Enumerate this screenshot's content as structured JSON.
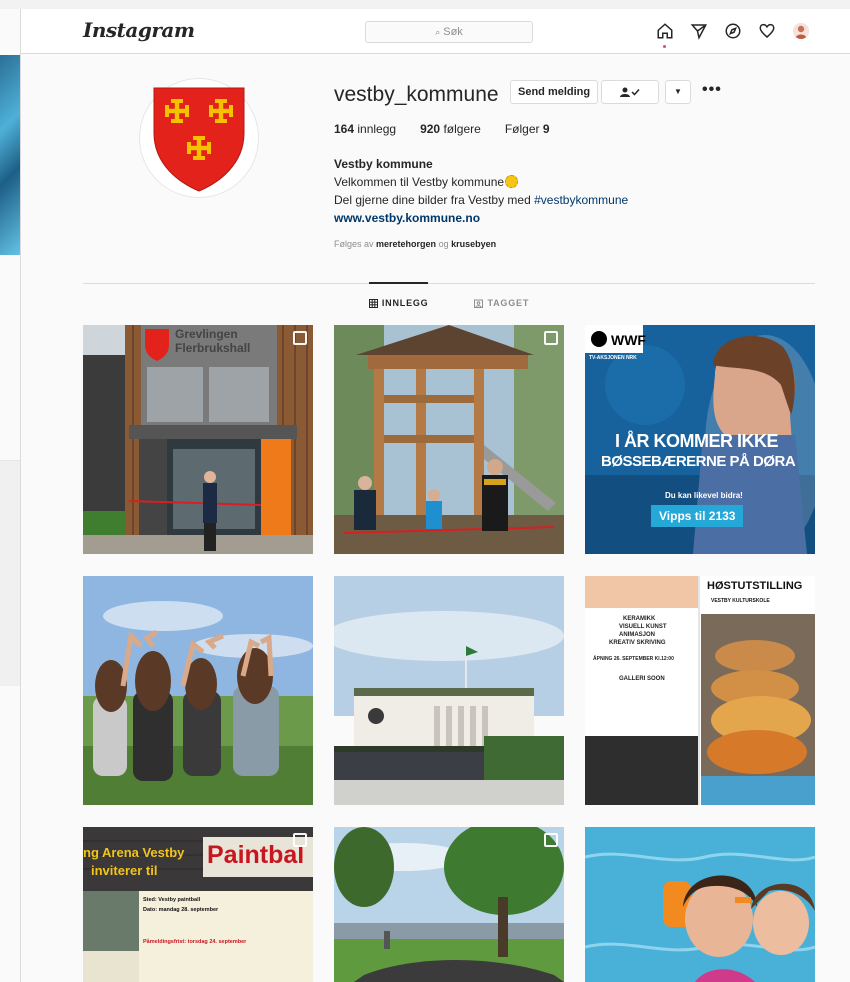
{
  "app": {
    "logo": "Instagram"
  },
  "search": {
    "placeholder": "Søk",
    "icon": "search-icon"
  },
  "nav": {
    "icons": [
      "home-icon",
      "direct-icon",
      "explore-icon",
      "activity-heart-icon",
      "profile-avatar-icon"
    ]
  },
  "profile": {
    "username": "vestby_kommune",
    "send_message_label": "Send melding",
    "posts_count": "164",
    "posts_label": "innlegg",
    "followers_count": "920",
    "followers_label": "følgere",
    "following_label": "Følger",
    "following_count": "9",
    "full_name": "Vestby kommune",
    "bio_line1": "Velkommen til Vestby kommune",
    "bio_line2_prefix": "Del gjerne dine bilder fra Vestby med",
    "hashtag": "#vestbykommune",
    "website": "www.vestby.kommune.no",
    "followed_by_prefix": "Følges av",
    "followed_by_user1": "meretehorgen",
    "followed_by_sep": "og",
    "followed_by_user2": "krusebyen"
  },
  "tabs": [
    {
      "label": "INNLEGG",
      "icon": "grid-icon",
      "active": true
    },
    {
      "label": "TAGGET",
      "icon": "tag-icon",
      "active": false
    }
  ],
  "posts": [
    {
      "overlay": [
        "Grevlingen",
        "Flerbrukshall"
      ]
    },
    {
      "overlay": []
    },
    {
      "overlay": [
        "WWF",
        "TV-AKSJONEN NRK",
        "I ÅR KOMMER IKKE",
        "BØSSEBÆRERNE PÅ DØRA",
        "Du kan likevel bidra!",
        "Vipps til 2133"
      ]
    },
    {
      "overlay": []
    },
    {
      "overlay": []
    },
    {
      "overlay": [
        "HØSTUTSTILLING",
        "VESTBY KULTURSKOLE",
        "KERAMIKK",
        "VISUELL KUNST",
        "ANIMASJON",
        "KREATIV SKRIVING",
        "ÅPNING 26. SEPTEMBER Kl.12:00",
        "GALLERI SOON"
      ]
    },
    {
      "overlay": [
        "ng Arena Vestby",
        "inviterer til",
        "Paintbal",
        "Sted: Vestby paintball",
        "Dato: mandag 28. september",
        "Påmeldingsfrist: torsdag 24. september"
      ]
    },
    {
      "overlay": []
    },
    {
      "overlay": []
    }
  ],
  "colors": {
    "accent": "#00376b",
    "text": "#262626",
    "muted": "#8e8e8e",
    "border": "#dbdbdb",
    "notification": "#ed4956",
    "wwf_blue": "#1a5a9a",
    "vipps": "#25a8d8"
  }
}
